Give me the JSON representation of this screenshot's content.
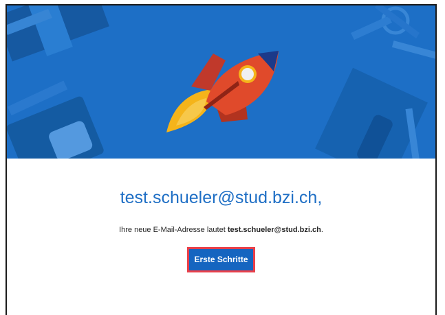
{
  "hero": {
    "illustration": "rocket-illustration",
    "background_color": "#1d6fc6",
    "accent_colors": [
      "#d8402b",
      "#f5b41a",
      "#1b3a8a",
      "#e9eef5"
    ]
  },
  "greeting": "test.schueler@stud.bzi.ch,",
  "message": {
    "prefix": "Ihre neue E-Mail-Adresse lautet ",
    "email": "test.schueler@stud.bzi.ch",
    "suffix": "."
  },
  "cta": {
    "label": "Erste Schritte",
    "highlight_color": "#e8404a",
    "button_color": "#1565c0"
  }
}
